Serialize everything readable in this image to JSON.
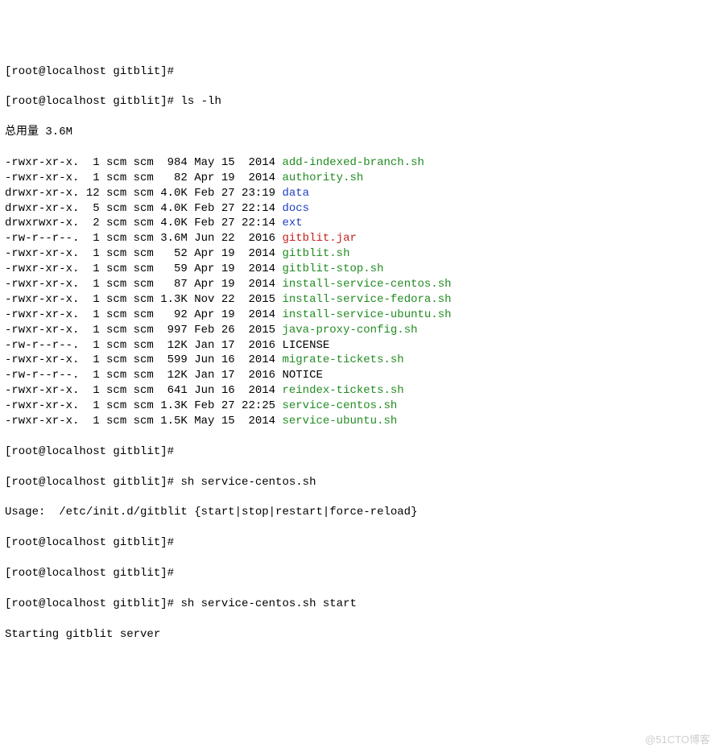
{
  "prompts": {
    "p1": "[root@localhost gitblit]# ",
    "p2": "[root@localhost gitblit]# "
  },
  "commands": {
    "ls": "ls -lh",
    "sh1": "sh service-centos.sh",
    "sh2": "sh service-centos.sh start"
  },
  "total": "总用量 3.6M",
  "files": [
    {
      "perm": "-rwxr-xr-x.",
      "links": " 1",
      "owner": "scm",
      "group": "scm",
      "size": " 984",
      "date": "May 15  2014",
      "name": "add-indexed-branch.sh",
      "cls": "green"
    },
    {
      "perm": "-rwxr-xr-x.",
      "links": " 1",
      "owner": "scm",
      "group": "scm",
      "size": "  82",
      "date": "Apr 19  2014",
      "name": "authority.sh",
      "cls": "green"
    },
    {
      "perm": "drwxr-xr-x.",
      "links": "12",
      "owner": "scm",
      "group": "scm",
      "size": "4.0K",
      "date": "Feb 27 23:19",
      "name": "data",
      "cls": "blue"
    },
    {
      "perm": "drwxr-xr-x.",
      "links": " 5",
      "owner": "scm",
      "group": "scm",
      "size": "4.0K",
      "date": "Feb 27 22:14",
      "name": "docs",
      "cls": "blue"
    },
    {
      "perm": "drwxrwxr-x.",
      "links": " 2",
      "owner": "scm",
      "group": "scm",
      "size": "4.0K",
      "date": "Feb 27 22:14",
      "name": "ext",
      "cls": "blue"
    },
    {
      "perm": "-rw-r--r--.",
      "links": " 1",
      "owner": "scm",
      "group": "scm",
      "size": "3.6M",
      "date": "Jun 22  2016",
      "name": "gitblit.jar",
      "cls": "red"
    },
    {
      "perm": "-rwxr-xr-x.",
      "links": " 1",
      "owner": "scm",
      "group": "scm",
      "size": "  52",
      "date": "Apr 19  2014",
      "name": "gitblit.sh",
      "cls": "green"
    },
    {
      "perm": "-rwxr-xr-x.",
      "links": " 1",
      "owner": "scm",
      "group": "scm",
      "size": "  59",
      "date": "Apr 19  2014",
      "name": "gitblit-stop.sh",
      "cls": "green"
    },
    {
      "perm": "-rwxr-xr-x.",
      "links": " 1",
      "owner": "scm",
      "group": "scm",
      "size": "  87",
      "date": "Apr 19  2014",
      "name": "install-service-centos.sh",
      "cls": "green"
    },
    {
      "perm": "-rwxr-xr-x.",
      "links": " 1",
      "owner": "scm",
      "group": "scm",
      "size": "1.3K",
      "date": "Nov 22  2015",
      "name": "install-service-fedora.sh",
      "cls": "green"
    },
    {
      "perm": "-rwxr-xr-x.",
      "links": " 1",
      "owner": "scm",
      "group": "scm",
      "size": "  92",
      "date": "Apr 19  2014",
      "name": "install-service-ubuntu.sh",
      "cls": "green"
    },
    {
      "perm": "-rwxr-xr-x.",
      "links": " 1",
      "owner": "scm",
      "group": "scm",
      "size": " 997",
      "date": "Feb 26  2015",
      "name": "java-proxy-config.sh",
      "cls": "green"
    },
    {
      "perm": "-rw-r--r--.",
      "links": " 1",
      "owner": "scm",
      "group": "scm",
      "size": " 12K",
      "date": "Jan 17  2016",
      "name": "LICENSE",
      "cls": ""
    },
    {
      "perm": "-rwxr-xr-x.",
      "links": " 1",
      "owner": "scm",
      "group": "scm",
      "size": " 599",
      "date": "Jun 16  2014",
      "name": "migrate-tickets.sh",
      "cls": "green"
    },
    {
      "perm": "-rw-r--r--.",
      "links": " 1",
      "owner": "scm",
      "group": "scm",
      "size": " 12K",
      "date": "Jan 17  2016",
      "name": "NOTICE",
      "cls": ""
    },
    {
      "perm": "-rwxr-xr-x.",
      "links": " 1",
      "owner": "scm",
      "group": "scm",
      "size": " 641",
      "date": "Jun 16  2014",
      "name": "reindex-tickets.sh",
      "cls": "green"
    },
    {
      "perm": "-rwxr-xr-x.",
      "links": " 1",
      "owner": "scm",
      "group": "scm",
      "size": "1.3K",
      "date": "Feb 27 22:25",
      "name": "service-centos.sh",
      "cls": "green"
    },
    {
      "perm": "-rwxr-xr-x.",
      "links": " 1",
      "owner": "scm",
      "group": "scm",
      "size": "1.5K",
      "date": "May 15  2014",
      "name": "service-ubuntu.sh",
      "cls": "green"
    }
  ],
  "usage": "Usage:  /etc/init.d/gitblit {start|stop|restart|force-reload}",
  "start_msg": "Starting gitblit server",
  "watermark": "@51CTO博客"
}
